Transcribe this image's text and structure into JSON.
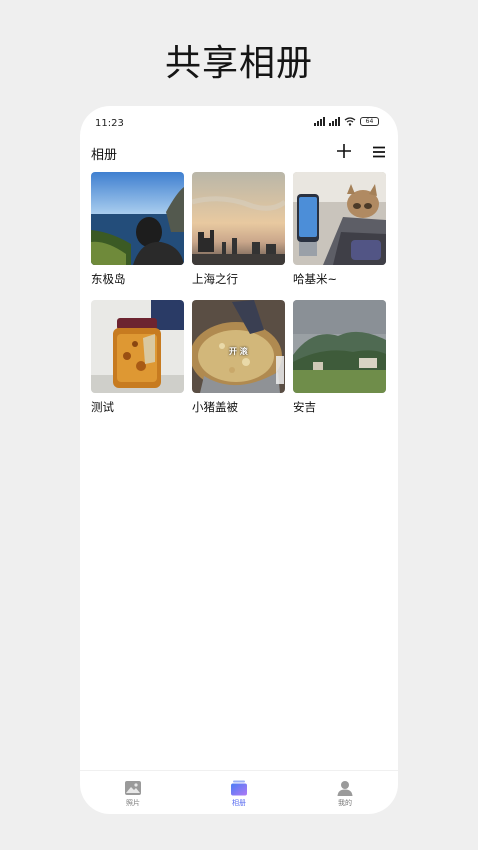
{
  "promo_title": "共享相册",
  "status_bar": {
    "time": "11:23",
    "battery": "64"
  },
  "header": {
    "title": "相册"
  },
  "albums": [
    {
      "name": "东极岛"
    },
    {
      "name": "上海之行"
    },
    {
      "name": "哈基米~"
    },
    {
      "name": "测试"
    },
    {
      "name": "小猪盖被",
      "overlay_text": "开 滚"
    },
    {
      "name": "安吉"
    }
  ],
  "tabs": [
    {
      "label": "照片",
      "icon": "photo-icon",
      "active": false
    },
    {
      "label": "相册",
      "icon": "album-icon",
      "active": true
    },
    {
      "label": "我的",
      "icon": "person-icon",
      "active": false
    }
  ],
  "colors": {
    "accent": "#5a6cf0",
    "background": "#efefef"
  }
}
